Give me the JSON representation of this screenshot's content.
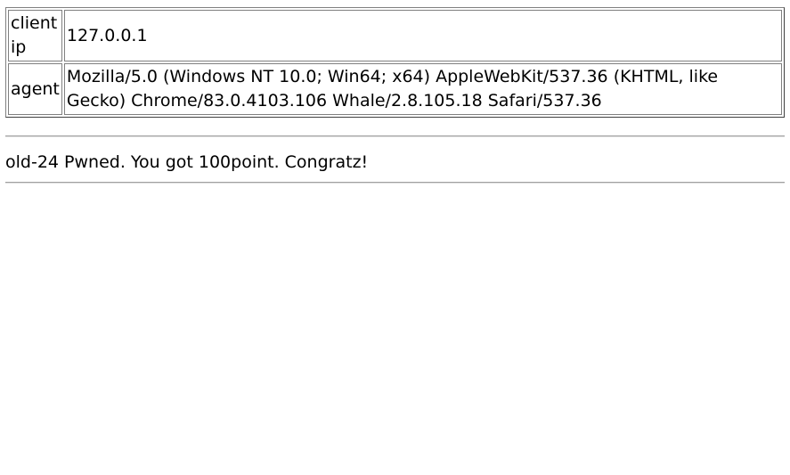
{
  "info_table": {
    "rows": [
      {
        "label": "client ip",
        "value": "127.0.0.1"
      },
      {
        "label": "agent",
        "value": "Mozilla/5.0 (Windows NT 10.0; Win64; x64) AppleWebKit/537.36 (KHTML, like Gecko) Chrome/83.0.4103.106 Whale/2.8.105.18 Safari/537.36"
      }
    ]
  },
  "result_message": "old-24 Pwned. You got 100point. Congratz!"
}
